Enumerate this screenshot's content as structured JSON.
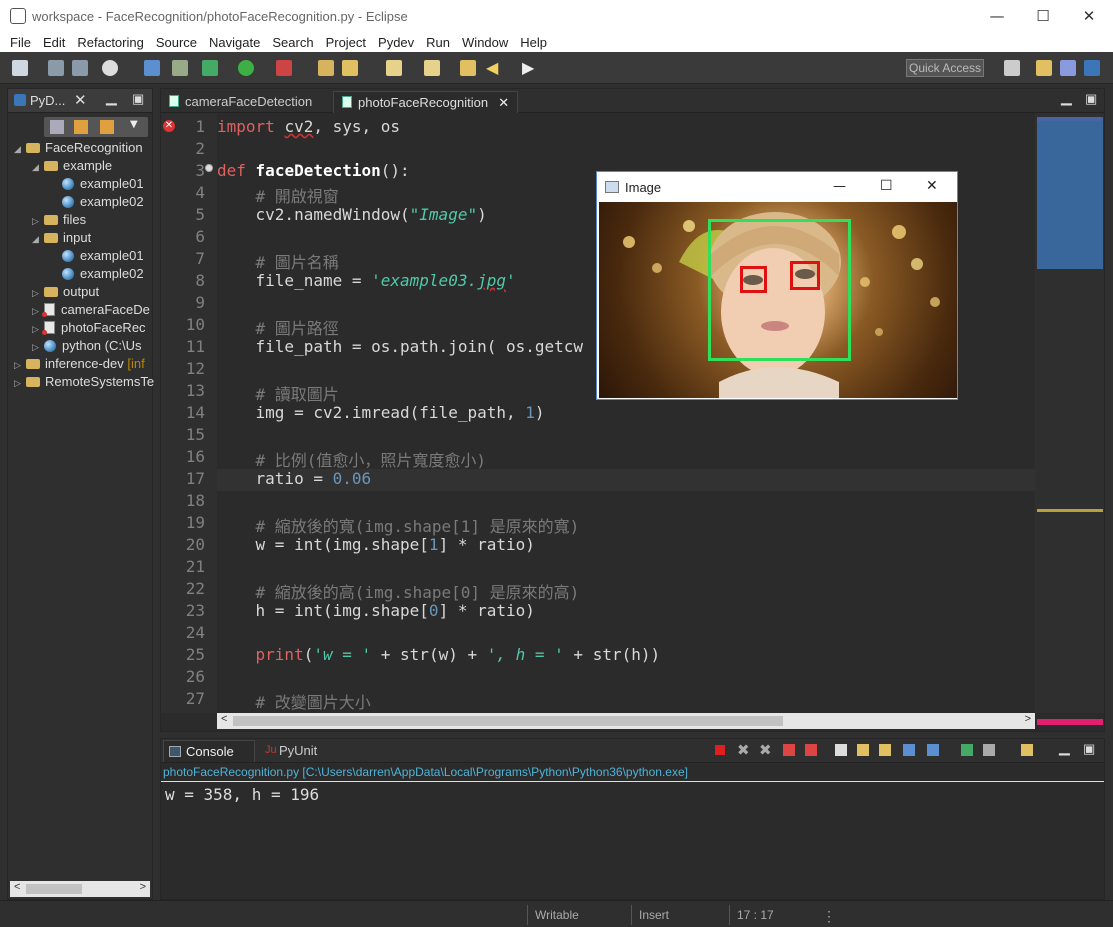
{
  "window": {
    "title": "workspace - FaceRecognition/photoFaceRecognition.py - Eclipse",
    "minimize": "—",
    "maximize": "☐",
    "close": "✕"
  },
  "menu": [
    "File",
    "Edit",
    "Refactoring",
    "Source",
    "Navigate",
    "Search",
    "Project",
    "Pydev",
    "Run",
    "Window",
    "Help"
  ],
  "toolbar": {
    "quick_access": "Quick Access"
  },
  "explorer": {
    "tab_label": "PyD...",
    "tree": [
      {
        "label": "FaceRecognition",
        "indent": 0,
        "type": "project",
        "expanded": true
      },
      {
        "label": "example",
        "indent": 1,
        "type": "folder",
        "expanded": true
      },
      {
        "label": "example01",
        "indent": 2,
        "type": "image"
      },
      {
        "label": "example02",
        "indent": 2,
        "type": "image"
      },
      {
        "label": "files",
        "indent": 1,
        "type": "folder",
        "expanded": false
      },
      {
        "label": "input",
        "indent": 1,
        "type": "folder",
        "expanded": true
      },
      {
        "label": "example01",
        "indent": 2,
        "type": "image"
      },
      {
        "label": "example02",
        "indent": 2,
        "type": "image"
      },
      {
        "label": "output",
        "indent": 1,
        "type": "folder",
        "expanded": false
      },
      {
        "label": "cameraFaceDe",
        "indent": 1,
        "type": "pyfile",
        "expanded": false
      },
      {
        "label": "photoFaceRec",
        "indent": 1,
        "type": "pyfile",
        "expanded": false
      },
      {
        "label": "python  (C:\\Us",
        "indent": 1,
        "type": "python",
        "expanded": false
      },
      {
        "label": "inference-dev",
        "suffix": "[inf",
        "indent": 0,
        "type": "project",
        "expanded": false
      },
      {
        "label": "RemoteSystemsTe",
        "indent": 0,
        "type": "folder",
        "expanded": false
      }
    ]
  },
  "editor": {
    "tabs": [
      {
        "label": "cameraFaceDetection",
        "active": false
      },
      {
        "label": "photoFaceRecognition",
        "active": true
      }
    ],
    "current_line": 17,
    "lines": [
      {
        "n": "1",
        "html": "<span class='kw'>import</span> <span style='text-decoration:underline wavy #c33'>cv2</span>, sys, os"
      },
      {
        "n": "2",
        "html": ""
      },
      {
        "n": "3",
        "html": "<span class='kw'>def</span> <span class='fn'>faceDetection</span>():"
      },
      {
        "n": "4",
        "html": "    <span class='cmt'># 開啟視窗</span>"
      },
      {
        "n": "5",
        "html": "    cv2.namedWindow(<span class='str'>\"Image\"</span>)"
      },
      {
        "n": "6",
        "html": ""
      },
      {
        "n": "7",
        "html": "    <span class='cmt'># 圖片名稱</span>"
      },
      {
        "n": "8",
        "html": "    file_name = <span class='str'>'example03.<span style=\"text-decoration:underline wavy #c33\">jpg</span>'</span>"
      },
      {
        "n": "9",
        "html": ""
      },
      {
        "n": "10",
        "html": "    <span class='cmt'># 圖片路徑</span>"
      },
      {
        "n": "11",
        "html": "    file_path = os.path.join( os.getcw"
      },
      {
        "n": "12",
        "html": ""
      },
      {
        "n": "13",
        "html": "    <span class='cmt'># 讀取圖片</span>"
      },
      {
        "n": "14",
        "html": "    img = cv2.imread(file_path, <span class='num'>1</span>)"
      },
      {
        "n": "15",
        "html": ""
      },
      {
        "n": "16",
        "html": "    <span class='cmt'># 比例(值愈小，照片寬度愈小)</span>"
      },
      {
        "n": "17",
        "html": "    ratio = <span class='num'>0.06</span>"
      },
      {
        "n": "18",
        "html": ""
      },
      {
        "n": "19",
        "html": "    <span class='cmt'># 縮放後的寬(img.shape[1] 是原來的寬)</span>"
      },
      {
        "n": "20",
        "html": "    w = int(img.shape[<span class='num'>1</span>] * ratio)"
      },
      {
        "n": "21",
        "html": ""
      },
      {
        "n": "22",
        "html": "    <span class='cmt'># 縮放後的高(img.shape[0] 是原來的高)</span>"
      },
      {
        "n": "23",
        "html": "    h = int(img.shape[<span class='num'>0</span>] * ratio)"
      },
      {
        "n": "24",
        "html": ""
      },
      {
        "n": "25",
        "html": "    <span class='kw'>print</span>(<span class='str'>'w = '</span> + str(w) + <span class='str'>', h = '</span> + str(h))"
      },
      {
        "n": "26",
        "html": ""
      },
      {
        "n": "27",
        "html": "    <span class='cmt'># 改變圖片大小</span>"
      }
    ]
  },
  "console": {
    "tabs": [
      {
        "label": "Console",
        "active": true
      },
      {
        "label": "PyUnit",
        "active": false
      }
    ],
    "header": "photoFaceRecognition.py [C:\\Users\\darren\\AppData\\Local\\Programs\\Python\\Python36\\python.exe]",
    "output": "w = 358, h = 196"
  },
  "status": {
    "writable": "Writable",
    "insert": "Insert",
    "position": "17 : 17"
  },
  "image_window": {
    "title": "Image",
    "minimize": "—",
    "maximize": "☐",
    "close": "✕",
    "face_box_color": "#2fe05a",
    "eye_box_color": "#e01010"
  },
  "colors": {
    "editor_bg": "#2b2b2b",
    "keyword": "#e16060",
    "string": "#4fc9a9",
    "number": "#6897bb"
  }
}
